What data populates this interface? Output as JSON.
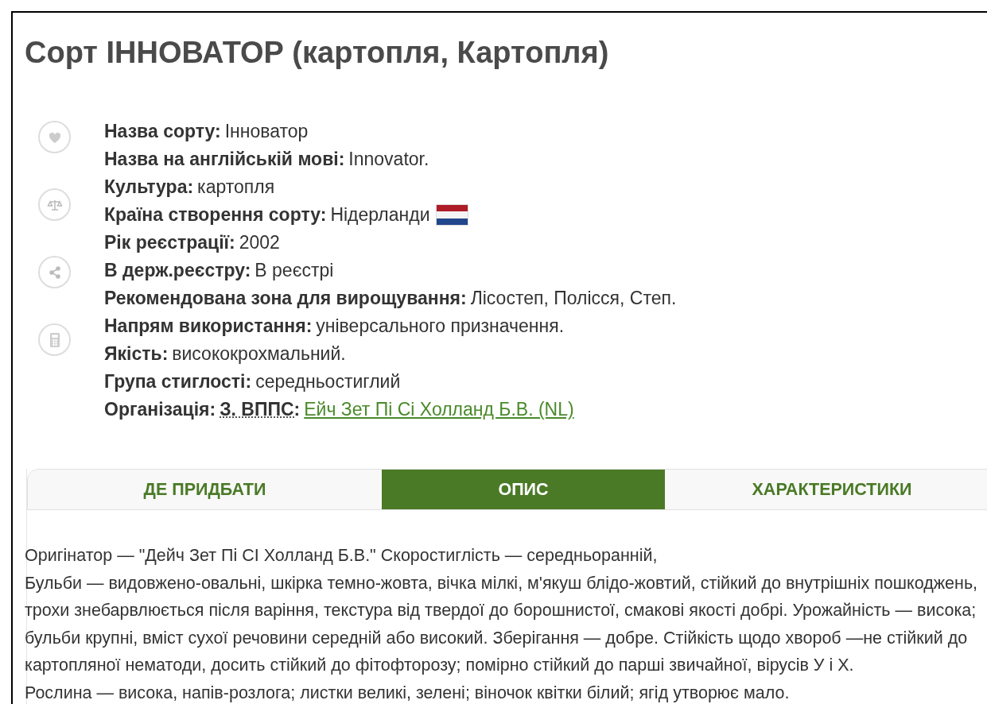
{
  "title": "Сорт ІННОВАТОР (картопля, Картопля)",
  "actions": [
    {
      "kind": "heart"
    },
    {
      "kind": "scales"
    },
    {
      "kind": "share"
    },
    {
      "kind": "calculator"
    }
  ],
  "fields": [
    {
      "kind": "text",
      "label": "Назва сорту:",
      "value": "Інноватор"
    },
    {
      "kind": "text",
      "label": "Назва на англійській мові:",
      "value": "Innovator."
    },
    {
      "kind": "text",
      "label": "Культура:",
      "value": "картопля"
    },
    {
      "kind": "flag",
      "label": "Країна створення сорту:",
      "value": "Нідерланди"
    },
    {
      "kind": "text",
      "label": "Рік реєстрації:",
      "value": "2002"
    },
    {
      "kind": "text",
      "label": "В держ.реєстру:",
      "value": "В реєстрі"
    },
    {
      "kind": "text",
      "label": "Рекомендована зона для вирощування:",
      "value": "Лісостеп, Полісся, Степ."
    },
    {
      "kind": "text",
      "label": "Напрям використання:",
      "value": "універсального призначення."
    },
    {
      "kind": "text",
      "label": "Якість:",
      "value": "висококрохмальний."
    },
    {
      "kind": "text",
      "label": "Група стиглості:",
      "value": "середньостиглий"
    },
    {
      "kind": "link",
      "label": "Організація:",
      "abbr": "З. ВППС",
      "suffix": ":",
      "value": "Ейч Зет Пі Сі Холланд Б.В. (NL)"
    }
  ],
  "tabs": [
    {
      "label": "ДЕ ПРИДБАТИ",
      "selected": false
    },
    {
      "label": "ОПИС",
      "selected": true
    },
    {
      "label": "ХАРАКТЕРИСТИКИ",
      "selected": false
    }
  ],
  "description": {
    "lines": [
      "Оригінатор — \"Дейч Зет Пі СІ Холланд Б.В.\" Скоростиглість — середньоранній,",
      "Бульби — видовжено-овальні, шкірка темно-жовта, вічка мілкі, м'якуш блідо-жовтий, стійкий до внутрішніх пошкоджень,",
      "трохи знебарвлюється після варіння, текстура від твердої до борошнистої, смакові якості добрі. Урожайність — висока;",
      "бульби крупні, вміст сухої речовини середній або високий. Зберігання — добре. Стійкість щодо хвороб —не стійкий до",
      "картопляної нематоди, досить стійкий до фітофторозу; помірно стійкий до парші звичайної, вірусів У і Х.",
      "Рослина — висока, напів-розлога; листки великі, зелені; віночок квітки білий; ягід утворює мало."
    ]
  }
}
